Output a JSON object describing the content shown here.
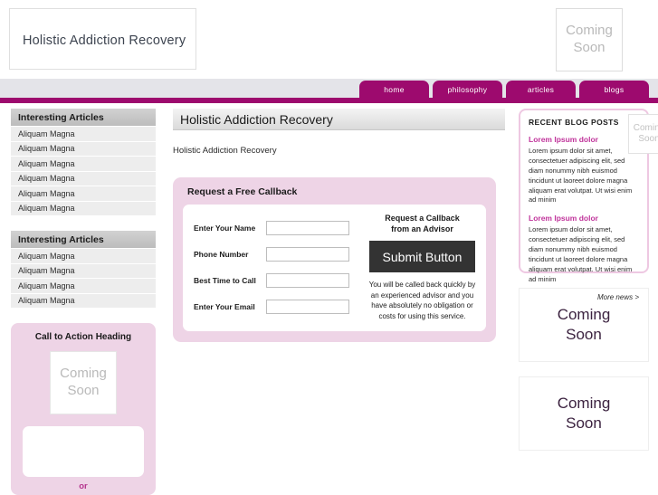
{
  "header": {
    "logo_text": "Holistic Addiction Recovery",
    "coming_soon_line1": "Coming",
    "coming_soon_line2": "Soon"
  },
  "nav": {
    "tabs": [
      {
        "label": "home"
      },
      {
        "label": "philosophy"
      },
      {
        "label": "articles"
      },
      {
        "label": "blogs"
      }
    ],
    "accent_color": "#9d0a6e",
    "strip_color": "#e4e4e9"
  },
  "sidebar_left": {
    "panels": [
      {
        "heading": "Interesting Articles",
        "items": [
          "Aliquam Magna",
          "Aliquam Magna",
          "Aliquam Magna",
          "Aliquam Magna",
          "Aliquam Magna",
          "Aliquam Magna"
        ]
      },
      {
        "heading": "Interesting Articles",
        "items": [
          "Aliquam Magna",
          "Aliquam Magna",
          "Aliquam Magna",
          "Aliquam Magna"
        ]
      }
    ],
    "cta": {
      "heading": "Call to Action Heading",
      "image_line1": "Coming",
      "image_line2": "Soon",
      "or_label": "or"
    }
  },
  "main": {
    "title": "Holistic Addiction Recovery",
    "intro": "Holistic Addiction Recovery",
    "form": {
      "heading": "Request a Free Callback",
      "fields": [
        {
          "label": "Enter Your Name",
          "value": "",
          "placeholder": ""
        },
        {
          "label": "Phone Number",
          "value": "",
          "placeholder": ""
        },
        {
          "label": "Best Time to Call",
          "value": "",
          "placeholder": ""
        },
        {
          "label": "Enter Your Email",
          "value": "",
          "placeholder": ""
        }
      ],
      "tagline_line1": "Request a Callback",
      "tagline_line2": "from an Advisor",
      "submit_label": "Submit Button",
      "note": "You will be called back quickly by an experienced advisor and you have absolutely no obligation or costs for using this service.",
      "panel_color": "#eed4e6",
      "button_color": "#333333"
    }
  },
  "sidebar_right": {
    "blog": {
      "heading": "RECENT BLOG POSTS",
      "coming_soon_line1": "Coming",
      "coming_soon_line2": "Soon",
      "posts": [
        {
          "title": "Lorem Ipsum dolor",
          "body": "Lorem ipsum dolor sit amet, consectetuer adipiscing elit, sed diam nonummy nibh euismod tincidunt ut laoreet dolore magna aliquam erat volutpat. Ut wisi enim ad minim"
        },
        {
          "title": "Lorem Ipsum dolor",
          "body": "Lorem ipsum dolor sit amet, consectetuer adipiscing elit, sed diam nonummy nibh euismod tincidunt ut laoreet dolore magna aliquam erat volutpat. Ut wisi enim ad minim"
        }
      ],
      "more_link": "More news >",
      "title_color": "#c0349b"
    },
    "placeholders": [
      {
        "line1": "Coming",
        "line2": "Soon"
      },
      {
        "line1": "Coming",
        "line2": "Soon"
      }
    ]
  }
}
